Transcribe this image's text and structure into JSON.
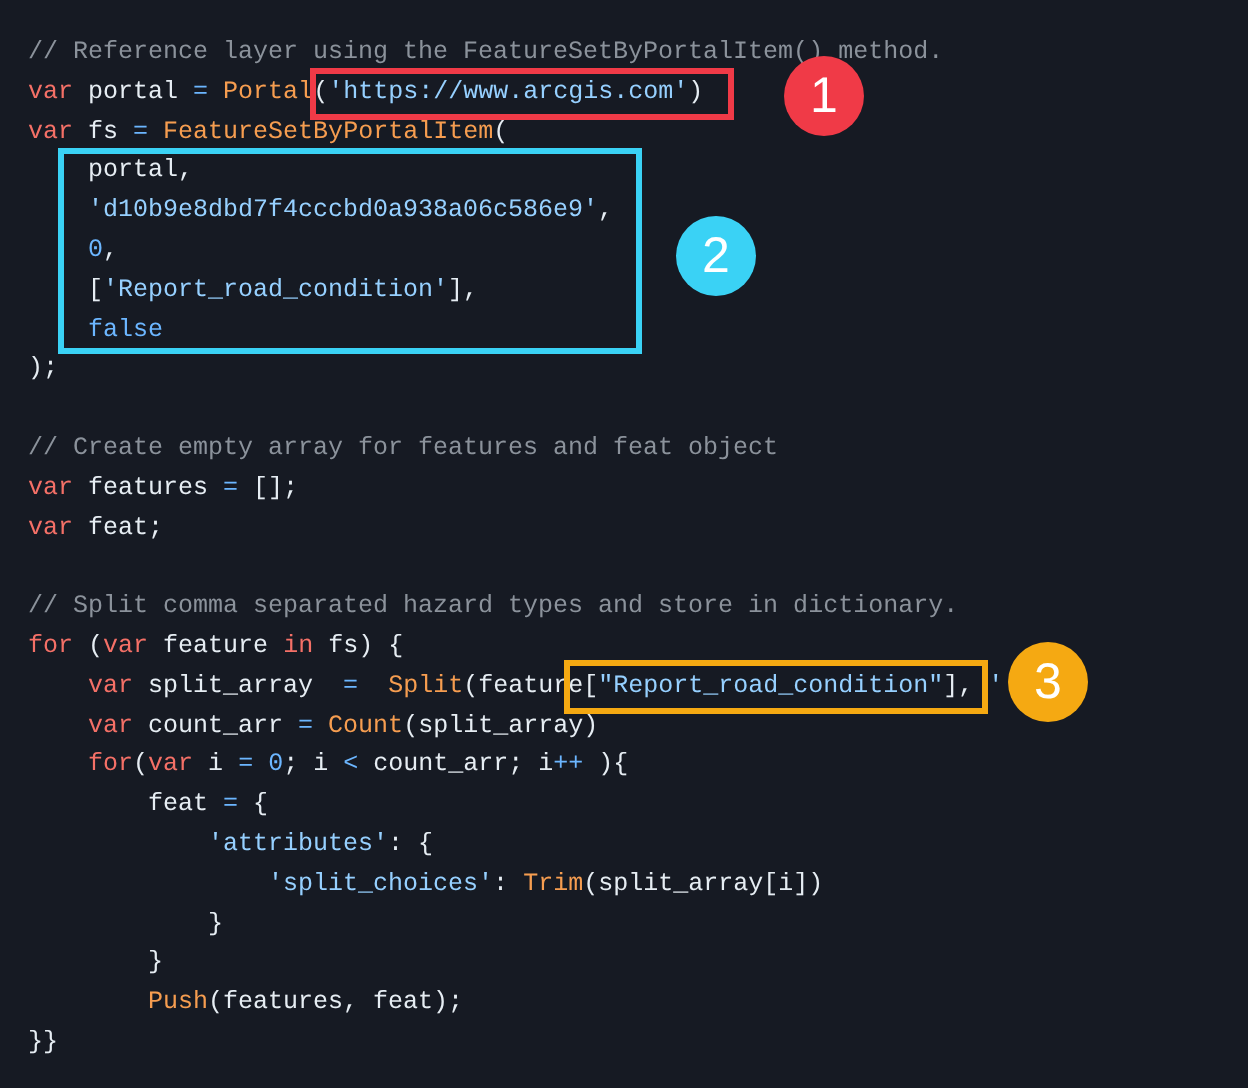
{
  "code_lines": [
    {
      "kind": "code",
      "tokens": [
        {
          "kind": "comment",
          "text": "// Reference layer using the FeatureSetByPortalItem() method."
        }
      ]
    },
    {
      "kind": "code",
      "tokens": [
        {
          "kind": "keyword",
          "text": "var"
        },
        {
          "kind": "plain",
          "text": " portal "
        },
        {
          "kind": "op",
          "text": "="
        },
        {
          "kind": "func",
          "text": " Portal"
        },
        {
          "kind": "plain",
          "text": "("
        },
        {
          "kind": "string",
          "text": "'https://www.arcgis.com'"
        },
        {
          "kind": "plain",
          "text": ")"
        }
      ]
    },
    {
      "kind": "code",
      "tokens": [
        {
          "kind": "keyword",
          "text": "var"
        },
        {
          "kind": "plain",
          "text": " fs "
        },
        {
          "kind": "op",
          "text": "="
        },
        {
          "kind": "func",
          "text": " FeatureSetByPortalItem"
        },
        {
          "kind": "plain",
          "text": "("
        }
      ]
    },
    {
      "kind": "code",
      "tokens": [
        {
          "kind": "plain",
          "text": "    portal,"
        }
      ]
    },
    {
      "kind": "code",
      "tokens": [
        {
          "kind": "string",
          "text": "    'd10b9e8dbd7f4cccbd0a938a06c586e9'"
        },
        {
          "kind": "plain",
          "text": ","
        }
      ]
    },
    {
      "kind": "code",
      "tokens": [
        {
          "kind": "number",
          "text": "    0"
        },
        {
          "kind": "plain",
          "text": ","
        }
      ]
    },
    {
      "kind": "code",
      "tokens": [
        {
          "kind": "plain",
          "text": "    ["
        },
        {
          "kind": "string",
          "text": "'Report_road_condition'"
        },
        {
          "kind": "plain",
          "text": "],"
        }
      ]
    },
    {
      "kind": "code",
      "tokens": [
        {
          "kind": "number",
          "text": "    false"
        }
      ]
    },
    {
      "kind": "code",
      "tokens": [
        {
          "kind": "plain",
          "text": ");"
        }
      ]
    },
    {
      "kind": "blank"
    },
    {
      "kind": "code",
      "tokens": [
        {
          "kind": "comment",
          "text": "// Create empty array for features and feat object"
        }
      ]
    },
    {
      "kind": "code",
      "tokens": [
        {
          "kind": "keyword",
          "text": "var"
        },
        {
          "kind": "plain",
          "text": " features "
        },
        {
          "kind": "op",
          "text": "="
        },
        {
          "kind": "plain",
          "text": " [];"
        }
      ]
    },
    {
      "kind": "code",
      "tokens": [
        {
          "kind": "keyword",
          "text": "var"
        },
        {
          "kind": "plain",
          "text": " feat;"
        }
      ]
    },
    {
      "kind": "blank"
    },
    {
      "kind": "code",
      "tokens": [
        {
          "kind": "comment",
          "text": "// Split comma separated hazard types and store in dictionary."
        }
      ]
    },
    {
      "kind": "code",
      "tokens": [
        {
          "kind": "keyword",
          "text": "for"
        },
        {
          "kind": "plain",
          "text": " ("
        },
        {
          "kind": "keyword",
          "text": "var"
        },
        {
          "kind": "plain",
          "text": " feature "
        },
        {
          "kind": "keyword",
          "text": "in"
        },
        {
          "kind": "plain",
          "text": " fs) {"
        }
      ]
    },
    {
      "kind": "code",
      "tokens": [
        {
          "kind": "keyword",
          "text": "    var"
        },
        {
          "kind": "plain",
          "text": " split_array  "
        },
        {
          "kind": "op",
          "text": "="
        },
        {
          "kind": "func",
          "text": "  Split"
        },
        {
          "kind": "plain",
          "text": "(feature["
        },
        {
          "kind": "string",
          "text": "\"Report_road_condition\""
        },
        {
          "kind": "plain",
          "text": "], "
        },
        {
          "kind": "string",
          "text": "'"
        }
      ]
    },
    {
      "kind": "code",
      "tokens": [
        {
          "kind": "keyword",
          "text": "    var"
        },
        {
          "kind": "plain",
          "text": " count_arr "
        },
        {
          "kind": "op",
          "text": "="
        },
        {
          "kind": "func",
          "text": " Count"
        },
        {
          "kind": "plain",
          "text": "(split_array)"
        }
      ]
    },
    {
      "kind": "code",
      "tokens": [
        {
          "kind": "keyword",
          "text": "    for"
        },
        {
          "kind": "plain",
          "text": "("
        },
        {
          "kind": "keyword",
          "text": "var"
        },
        {
          "kind": "plain",
          "text": " i "
        },
        {
          "kind": "op",
          "text": "="
        },
        {
          "kind": "number",
          "text": " 0"
        },
        {
          "kind": "plain",
          "text": "; i "
        },
        {
          "kind": "op",
          "text": "<"
        },
        {
          "kind": "plain",
          "text": " count_arr; i"
        },
        {
          "kind": "op",
          "text": "++"
        },
        {
          "kind": "plain",
          "text": " ){"
        }
      ]
    },
    {
      "kind": "code",
      "tokens": [
        {
          "kind": "plain",
          "text": "        feat "
        },
        {
          "kind": "op",
          "text": "="
        },
        {
          "kind": "plain",
          "text": " {"
        }
      ]
    },
    {
      "kind": "code",
      "tokens": [
        {
          "kind": "string",
          "text": "            'attributes'"
        },
        {
          "kind": "plain",
          "text": ": {"
        }
      ]
    },
    {
      "kind": "code",
      "tokens": [
        {
          "kind": "string",
          "text": "                'split_choices'"
        },
        {
          "kind": "plain",
          "text": ": "
        },
        {
          "kind": "func",
          "text": "Trim"
        },
        {
          "kind": "plain",
          "text": "(split_array[i])"
        }
      ]
    },
    {
      "kind": "code",
      "tokens": [
        {
          "kind": "plain",
          "text": "            }"
        }
      ]
    },
    {
      "kind": "code",
      "tokens": [
        {
          "kind": "plain",
          "text": "        }"
        }
      ]
    },
    {
      "kind": "code",
      "tokens": [
        {
          "kind": "func",
          "text": "        Push"
        },
        {
          "kind": "plain",
          "text": "(features, feat);"
        }
      ]
    },
    {
      "kind": "code",
      "tokens": [
        {
          "kind": "plain",
          "text": "}}"
        }
      ]
    }
  ],
  "annotations": [
    {
      "number": "1",
      "color": "#f03a47"
    },
    {
      "number": "2",
      "color": "#3ad2f5"
    },
    {
      "number": "3",
      "color": "#f5a912"
    }
  ]
}
